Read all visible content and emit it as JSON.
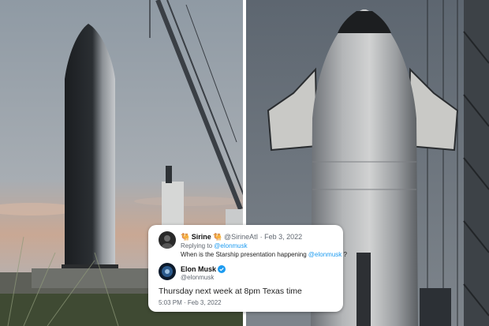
{
  "colors": {
    "twitter_blue": "#1d9bf0",
    "tweet_text": "#222222",
    "meta_text": "#606770"
  },
  "tweets": {
    "reply": {
      "display_name": "🐫 Sirine 🐫",
      "handle": "@SirineAtI",
      "date": "· Feb 3, 2022",
      "replying_prefix": "Replying to",
      "replying_handle": "@elonmusk",
      "text_before": "When is the Starship presentation happening",
      "mention": "@elonmusk",
      "text_after": "?"
    },
    "answer": {
      "display_name": "Elon Musk",
      "verified_icon": "verified-badge-icon",
      "handle": "@elonmusk",
      "text": "Thursday next week at 8pm Texas time",
      "time": "5:03 PM",
      "date": "· Feb 3, 2022"
    }
  }
}
